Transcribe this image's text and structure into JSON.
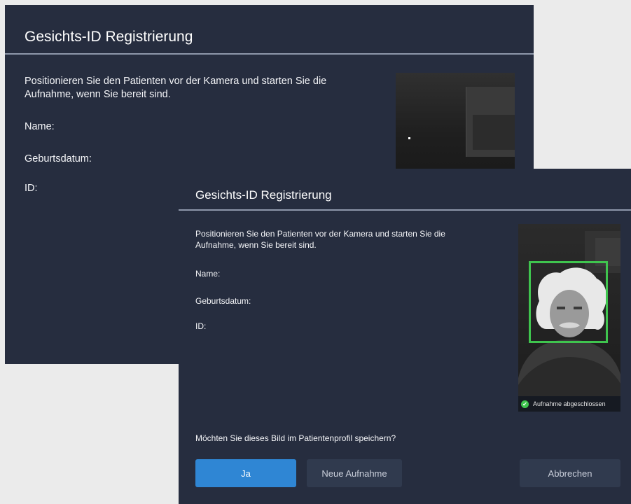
{
  "dialog_back": {
    "title": "Gesichts-ID Registrierung",
    "instruction_line1": "Positionieren Sie den Patienten vor der Kamera und starten Sie die",
    "instruction_line2": "Aufnahme, wenn Sie bereit sind.",
    "name_label": "Name:",
    "birthdate_label": "Geburtsdatum:",
    "id_label": "ID:"
  },
  "dialog_front": {
    "title": "Gesichts-ID Registrierung",
    "instruction_line1": "Positionieren Sie den Patienten vor der Kamera und starten Sie die",
    "instruction_line2": "Aufnahme, wenn Sie bereit sind.",
    "name_label": "Name:",
    "birthdate_label": "Geburtsdatum:",
    "id_label": "ID:",
    "camera_status": "Aufnahme abgeschlossen",
    "question": "Möchten Sie dieses Bild im Patientenprofil speichern?",
    "buttons": {
      "yes": "Ja",
      "new_capture": "Neue Aufnahme",
      "cancel": "Abbrechen"
    }
  },
  "colors": {
    "dialog_bg": "#262d3f",
    "divider": "#8d97aa",
    "primary_button": "#2f86d4",
    "secondary_button": "#303a4e",
    "success": "#3fc44e"
  }
}
